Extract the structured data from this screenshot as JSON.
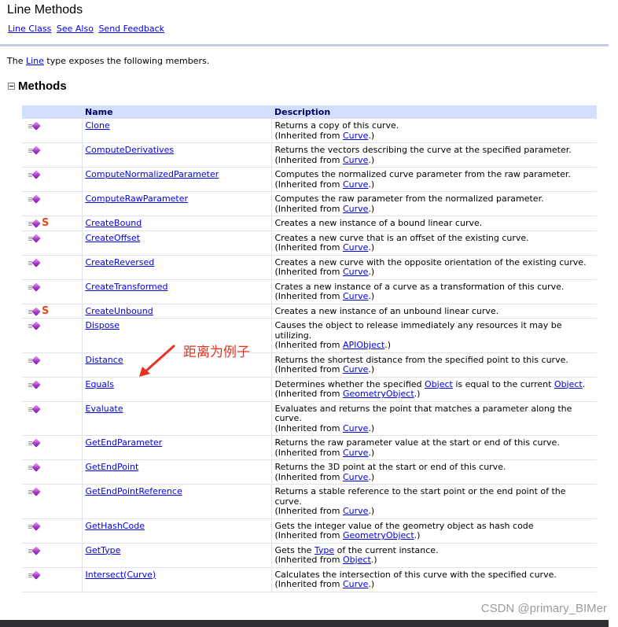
{
  "header": {
    "title": "Line Methods",
    "links": [
      "Line Class",
      "See Also",
      "Send Feedback"
    ]
  },
  "intro": {
    "prefix": "The ",
    "link": "Line",
    "suffix": " type exposes the following members."
  },
  "section": {
    "title": "Methods"
  },
  "table": {
    "columns": [
      "",
      "Name",
      "Description"
    ],
    "rows": [
      {
        "name": "Clone",
        "static": false,
        "desc": "Returns a copy of this curve.",
        "inherited": "Curve"
      },
      {
        "name": "ComputeDerivatives",
        "static": false,
        "desc": "Returns the vectors describing the curve at the specified parameter.",
        "inherited": "Curve"
      },
      {
        "name": "ComputeNormalizedParameter",
        "static": false,
        "desc": "Computes the normalized curve parameter from the raw parameter.",
        "inherited": "Curve"
      },
      {
        "name": "ComputeRawParameter",
        "static": false,
        "desc": "Computes the raw parameter from the normalized parameter.",
        "inherited": "Curve"
      },
      {
        "name": "CreateBound",
        "static": true,
        "desc": "Creates a new instance of a bound linear curve.",
        "inherited": ""
      },
      {
        "name": "CreateOffset",
        "static": false,
        "desc": "Creates a new curve that is an offset of the existing curve.",
        "inherited": "Curve"
      },
      {
        "name": "CreateReversed",
        "static": false,
        "desc": "Creates a new curve with the opposite orientation of the existing curve.",
        "inherited": "Curve"
      },
      {
        "name": "CreateTransformed",
        "static": false,
        "desc": "Crates a new instance of a curve as a transformation of this curve.",
        "inherited": "Curve"
      },
      {
        "name": "CreateUnbound",
        "static": true,
        "desc": "Creates a new instance of an unbound linear curve.",
        "inherited": ""
      },
      {
        "name": "Dispose",
        "static": false,
        "desc": "Causes the object to release immediately any resources it may be utilizing.",
        "inherited": "APIObject"
      },
      {
        "name": "Distance",
        "static": false,
        "desc": "Returns the shortest distance from the specified point to this curve.",
        "inherited": "Curve"
      },
      {
        "name": "Equals",
        "static": false,
        "desc_parts": [
          "Determines whether the specified ",
          "Object",
          " is equal to the current ",
          "Object",
          "."
        ],
        "inherited": "GeometryObject"
      },
      {
        "name": "Evaluate",
        "static": false,
        "desc": "Evaluates and returns the point that matches a parameter along the curve.",
        "inherited": "Curve"
      },
      {
        "name": "GetEndParameter",
        "static": false,
        "desc": "Returns the raw parameter value at the start or end of this curve.",
        "inherited": "Curve"
      },
      {
        "name": "GetEndPoint",
        "static": false,
        "desc": "Returns the 3D point at the start or end of this curve.",
        "inherited": "Curve"
      },
      {
        "name": "GetEndPointReference",
        "static": false,
        "desc": "Returns a stable reference to the start point or the end point of the curve.",
        "inherited": "Curve"
      },
      {
        "name": "GetHashCode",
        "static": false,
        "desc": "Gets the integer value of the geometry object as hash code",
        "inherited": "GeometryObject"
      },
      {
        "name": "GetType",
        "static": false,
        "desc_parts": [
          "Gets the ",
          "Type",
          " of the current instance."
        ],
        "inherited": "Object"
      },
      {
        "name": "Intersect(Curve)",
        "static": false,
        "desc": "Calculates the intersection of this curve with the specified curve.",
        "inherited": "Curve"
      }
    ],
    "inherited_prefix": "(Inherited from ",
    "inherited_suffix": ".)",
    "static_glyph": "S"
  },
  "annotation": {
    "text": "距离为例子",
    "color": "#e8321f"
  },
  "watermark": "CSDN @primary_BIMer",
  "colors": {
    "link": "#0000ee",
    "header_bg": "#d4dfff",
    "annotation": "#e8321f",
    "static_icon": "#e0501a"
  }
}
